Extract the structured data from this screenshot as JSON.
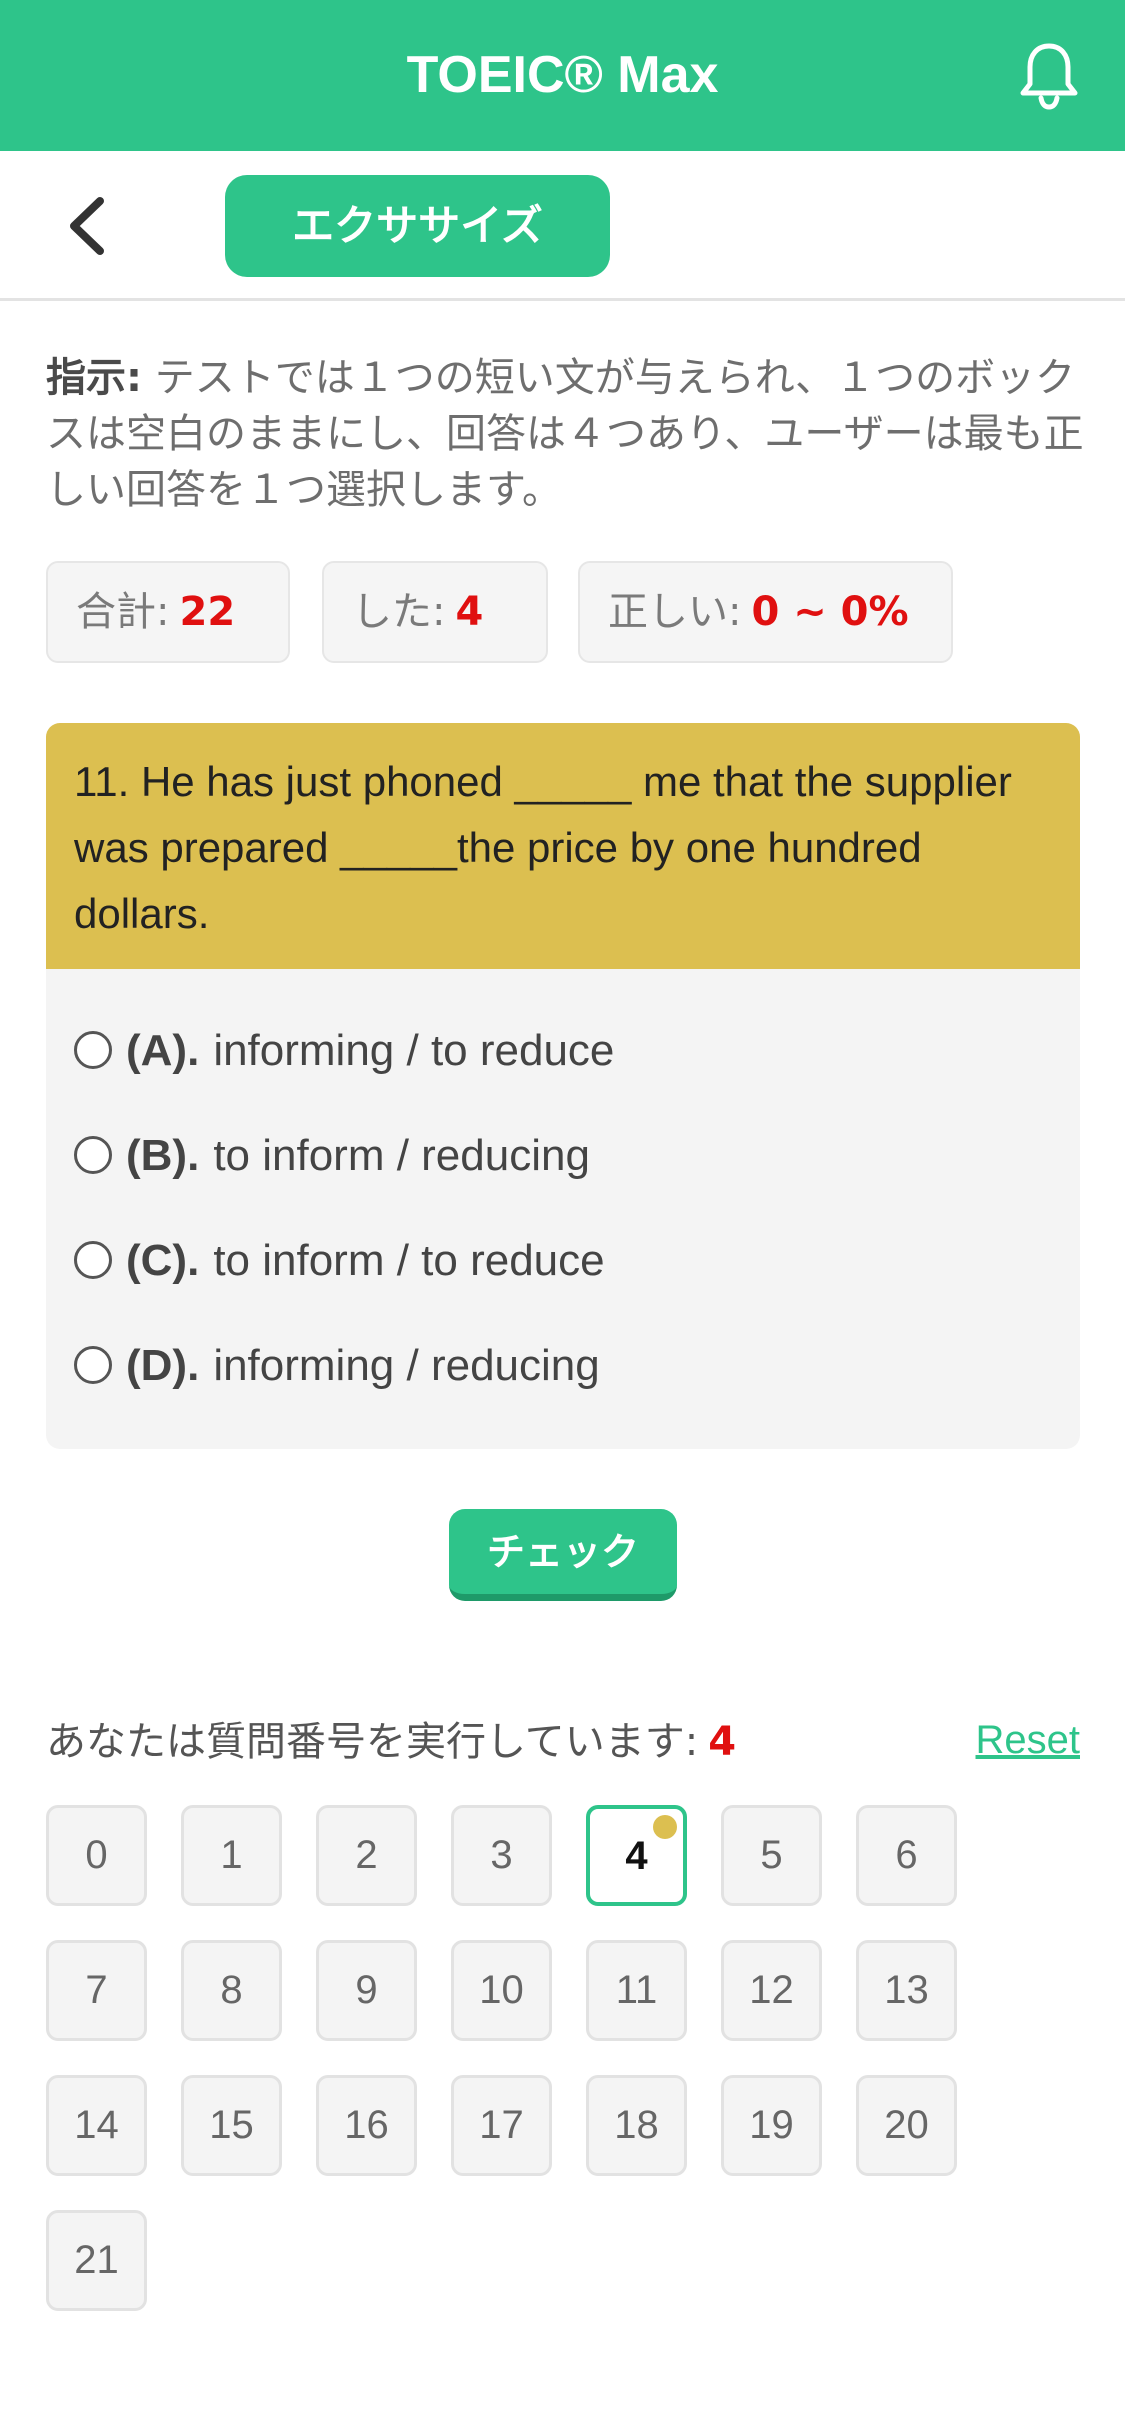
{
  "header": {
    "title": "TOEIC® Max",
    "bell_icon": "bell-icon"
  },
  "subbar": {
    "back_icon": "chevron-left-icon",
    "tab_label": "エクササイズ"
  },
  "instructions": {
    "label": "指示:",
    "text": "テストでは１つの短い文が与えられ、１つのボックスは空白のままにし、回答は４つあり、ユーザーは最も正しい回答を１つ選択します。"
  },
  "stats": {
    "total_label": "合計:",
    "total_value": "22",
    "done_label": "した:",
    "done_value": "4",
    "correct_label": "正しい:",
    "correct_value": "0 ~ 0%"
  },
  "question": {
    "text": "11. He has just phoned _____ me that the supplier was prepared _____the price by one hundred dollars.",
    "options": [
      {
        "label": "(A).",
        "text": "informing / to reduce"
      },
      {
        "label": "(B).",
        "text": "to inform / reducing"
      },
      {
        "label": "(C).",
        "text": "to inform / to reduce"
      },
      {
        "label": "(D).",
        "text": "informing / reducing"
      }
    ]
  },
  "check_button": "チェック",
  "progress": {
    "running_label": "あなたは質問番号を実行しています:",
    "current": "4",
    "reset_label": "Reset",
    "numbers": [
      "0",
      "1",
      "2",
      "3",
      "4",
      "5",
      "6",
      "7",
      "8",
      "9",
      "10",
      "11",
      "12",
      "13",
      "14",
      "15",
      "16",
      "17",
      "18",
      "19",
      "20",
      "21"
    ]
  },
  "colors": {
    "accent": "#2ec48a",
    "question_header": "#dcbf50",
    "highlight": "#e01010"
  }
}
